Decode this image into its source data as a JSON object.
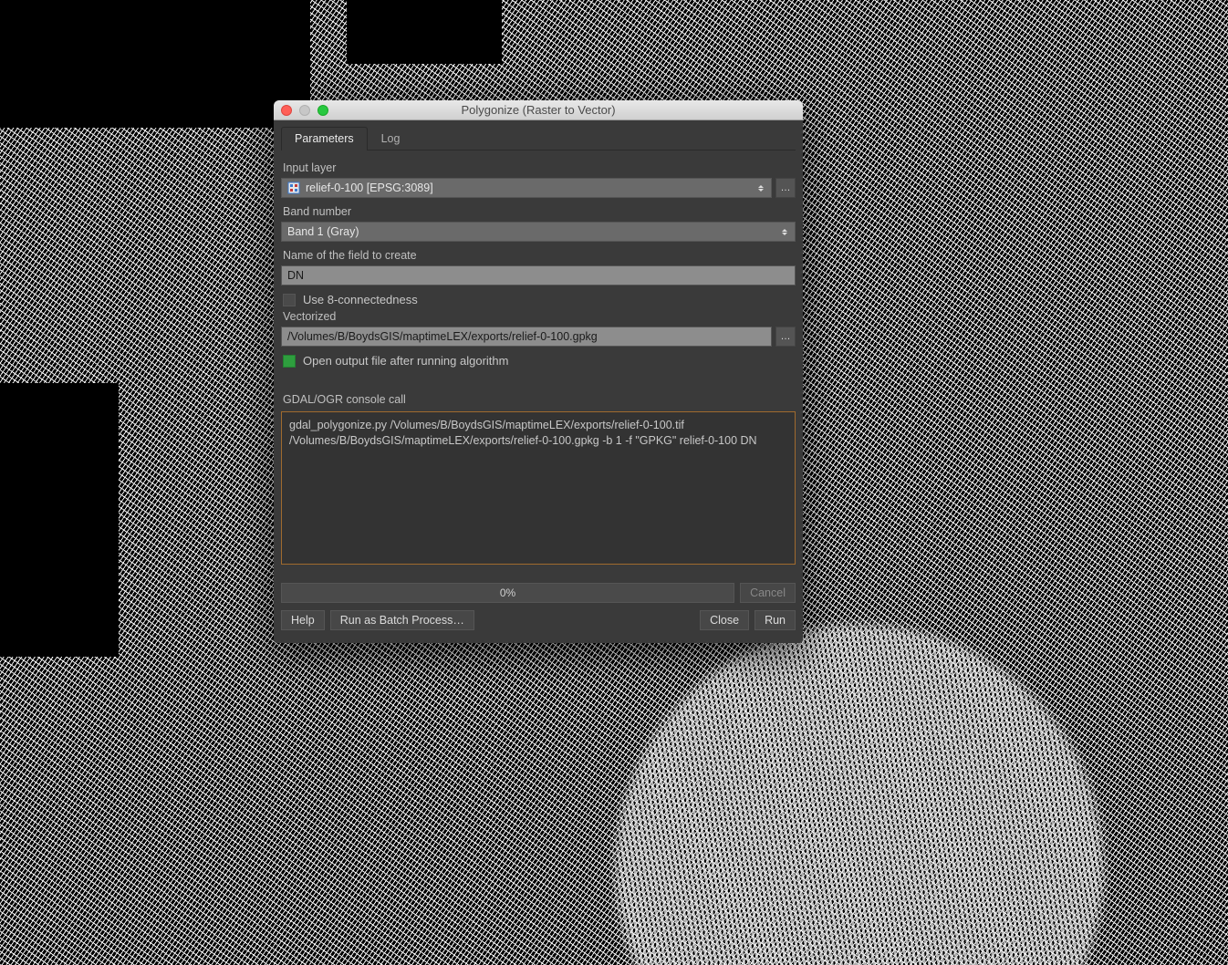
{
  "window": {
    "title": "Polygonize (Raster to Vector)"
  },
  "tabs": {
    "parameters": "Parameters",
    "log": "Log"
  },
  "form": {
    "input_layer_label": "Input layer",
    "input_layer_value": "relief-0-100 [EPSG:3089]",
    "band_label": "Band number",
    "band_value": "Band 1 (Gray)",
    "field_label": "Name of the field to create",
    "field_value": "DN",
    "connectedness_label": "Use 8-connectedness",
    "vectorized_label": "Vectorized",
    "vectorized_value": "/Volumes/B/BoydsGIS/maptimeLEX/exports/relief-0-100.gpkg",
    "open_output_label": "Open output file after running algorithm",
    "console_label": "GDAL/OGR console call",
    "console_text": "gdal_polygonize.py /Volumes/B/BoydsGIS/maptimeLEX/exports/relief-0-100.tif /Volumes/B/BoydsGIS/maptimeLEX/exports/relief-0-100.gpkg -b 1 -f \"GPKG\" relief-0-100 DN"
  },
  "progress": {
    "text": "0%",
    "cancel": "Cancel"
  },
  "footer": {
    "help": "Help",
    "batch": "Run as Batch Process…",
    "close": "Close",
    "run": "Run"
  },
  "browse_glyph": "…"
}
